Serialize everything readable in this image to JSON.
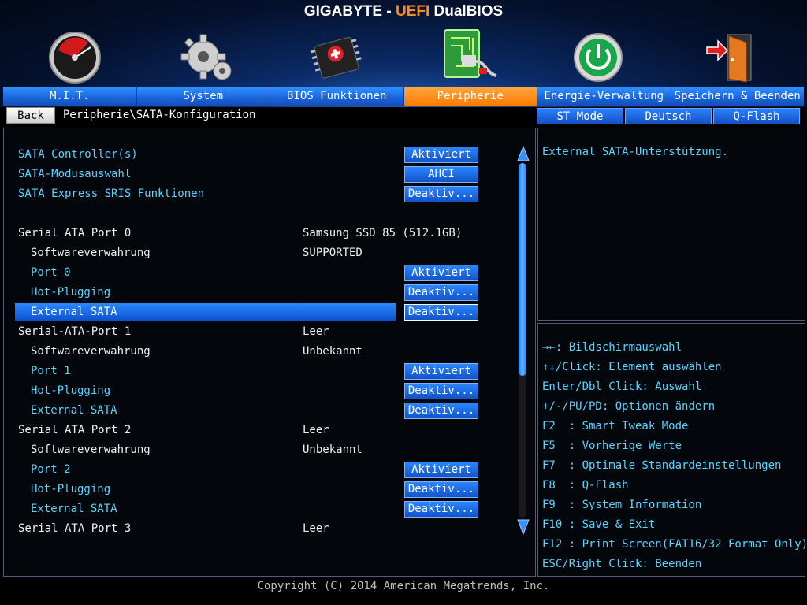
{
  "header": {
    "brand": "GIGABYTE",
    "sep": " - ",
    "accent": "UEFI",
    "suffix": " DualBIOS"
  },
  "tabs": [
    {
      "label": "M.I.T.",
      "icon": "speedometer-icon"
    },
    {
      "label": "System",
      "icon": "gear-icon"
    },
    {
      "label": "BIOS Funktionen",
      "icon": "chip-icon"
    },
    {
      "label": "Peripherie",
      "icon": "circuit-board-icon",
      "active": true
    },
    {
      "label": "Energie-Verwaltung",
      "icon": "power-icon"
    },
    {
      "label": "Speichern & Beenden",
      "icon": "exit-door-icon"
    }
  ],
  "subbar": {
    "back": "Back",
    "breadcrumb": "Peripherie\\SATA-Konfiguration",
    "st_mode": "ST Mode",
    "language": "Deutsch",
    "qflash": "Q-Flash"
  },
  "rows": [
    {
      "label": "SATA Controller(s)",
      "level": 0,
      "style": "cyan",
      "option": "Aktiviert"
    },
    {
      "label": "SATA-Modusauswahl",
      "level": 0,
      "style": "cyan",
      "option": "AHCI"
    },
    {
      "label": "SATA Express SRIS Funktionen",
      "level": 0,
      "style": "cyan",
      "option": "Deaktiv..."
    },
    {
      "label": "Serial ATA Port 0",
      "level": 0,
      "style": "white",
      "value": "Samsung SSD 85 (512.1GB)"
    },
    {
      "label": "Softwareverwahrung",
      "level": 1,
      "style": "white",
      "value": "SUPPORTED"
    },
    {
      "label": "Port 0",
      "level": 1,
      "style": "cyan",
      "option": "Aktiviert"
    },
    {
      "label": "Hot-Plugging",
      "level": 1,
      "style": "cyan",
      "option": "Deaktiv..."
    },
    {
      "label": "External SATA",
      "level": 1,
      "style": "cyan",
      "option": "Deaktiv...",
      "selected": true
    },
    {
      "label": "Serial-ATA-Port 1",
      "level": 0,
      "style": "white",
      "value": "Leer"
    },
    {
      "label": "Softwareverwahrung",
      "level": 1,
      "style": "white",
      "value": "Unbekannt"
    },
    {
      "label": "Port 1",
      "level": 1,
      "style": "cyan",
      "option": "Aktiviert"
    },
    {
      "label": "Hot-Plugging",
      "level": 1,
      "style": "cyan",
      "option": "Deaktiv..."
    },
    {
      "label": "External SATA",
      "level": 1,
      "style": "cyan",
      "option": "Deaktiv..."
    },
    {
      "label": "Serial ATA Port 2",
      "level": 0,
      "style": "white",
      "value": "Leer"
    },
    {
      "label": "Softwareverwahrung",
      "level": 1,
      "style": "white",
      "value": "Unbekannt"
    },
    {
      "label": "Port 2",
      "level": 1,
      "style": "cyan",
      "option": "Aktiviert"
    },
    {
      "label": "Hot-Plugging",
      "level": 1,
      "style": "cyan",
      "option": "Deaktiv..."
    },
    {
      "label": "External SATA",
      "level": 1,
      "style": "cyan",
      "option": "Deaktiv..."
    },
    {
      "label": "Serial ATA Port 3",
      "level": 0,
      "style": "white",
      "value": "Leer"
    }
  ],
  "scroll_position": 0.6,
  "help": "External SATA-Unterstützung.",
  "keys": [
    "→←: Bildschirmauswahl",
    "↑↓/Click: Element auswählen",
    "Enter/Dbl Click: Auswahl",
    "+/-/PU/PD: Optionen ändern",
    "F2  : Smart Tweak Mode",
    "F5  : Vorherige Werte",
    "F7  : Optimale Standardeinstellungen",
    "F8  : Q-Flash",
    "F9  : System Information",
    "F10 : Save & Exit",
    "F12 : Print Screen(FAT16/32 Format Only)",
    "ESC/Right Click: Beenden"
  ],
  "copyright": "Copyright (C) 2014 American Megatrends, Inc.",
  "colors": {
    "accent": "#ff7a00",
    "highlight": "#1a63d9",
    "item_text": "#5ad4ff"
  }
}
